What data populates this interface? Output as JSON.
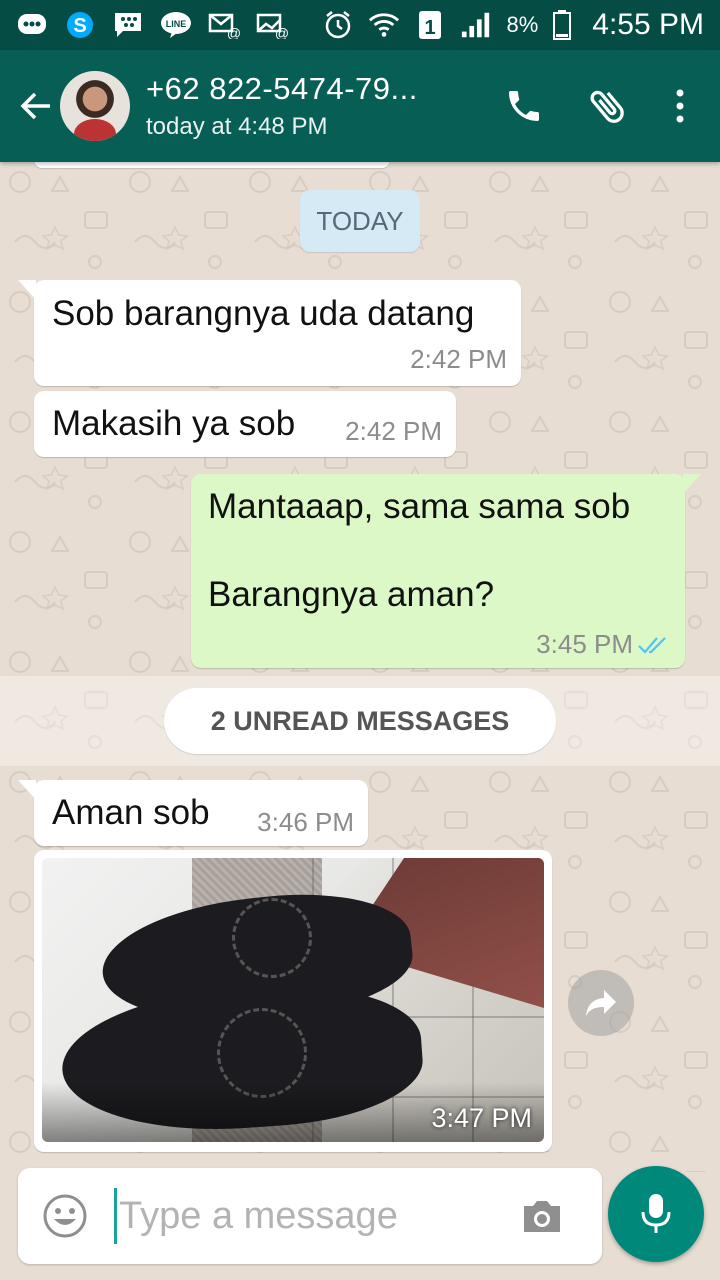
{
  "status_bar": {
    "icons": [
      "bbm-icon",
      "skype-icon",
      "blackberry-icon",
      "line-icon",
      "email-icon",
      "email-icon",
      "alarm-icon",
      "wifi-icon",
      "sim-icon",
      "signal-icon",
      "battery-icon"
    ],
    "sim": "1",
    "battery_pct": "8%",
    "time": "4:55 PM"
  },
  "header": {
    "contact_name": "+62 822-5474-79...",
    "last_seen": "today at 4:48 PM"
  },
  "chat": {
    "date_label": "TODAY",
    "unread_label": "2 UNREAD MESSAGES",
    "messages": [
      {
        "direction": "in",
        "text": "Sob barangnya uda datang",
        "time": "2:42 PM"
      },
      {
        "direction": "in",
        "text": "Makasih ya sob",
        "time": "2:42 PM"
      },
      {
        "direction": "out",
        "line1": "Mantaaap, sama sama sob",
        "line2": "Barangnya aman?",
        "time": "3:45 PM",
        "read": true
      },
      {
        "direction": "in",
        "text": "Aman sob",
        "time": "3:46 PM"
      },
      {
        "direction": "in",
        "type": "image",
        "time": "3:47 PM"
      }
    ]
  },
  "composer": {
    "placeholder": "Type a message"
  },
  "colors": {
    "status_bar": "#054d44",
    "header": "#075e54",
    "outgoing_bubble": "#dcf8c6",
    "accent": "#00897b",
    "read_ticks": "#4fc3f7"
  }
}
